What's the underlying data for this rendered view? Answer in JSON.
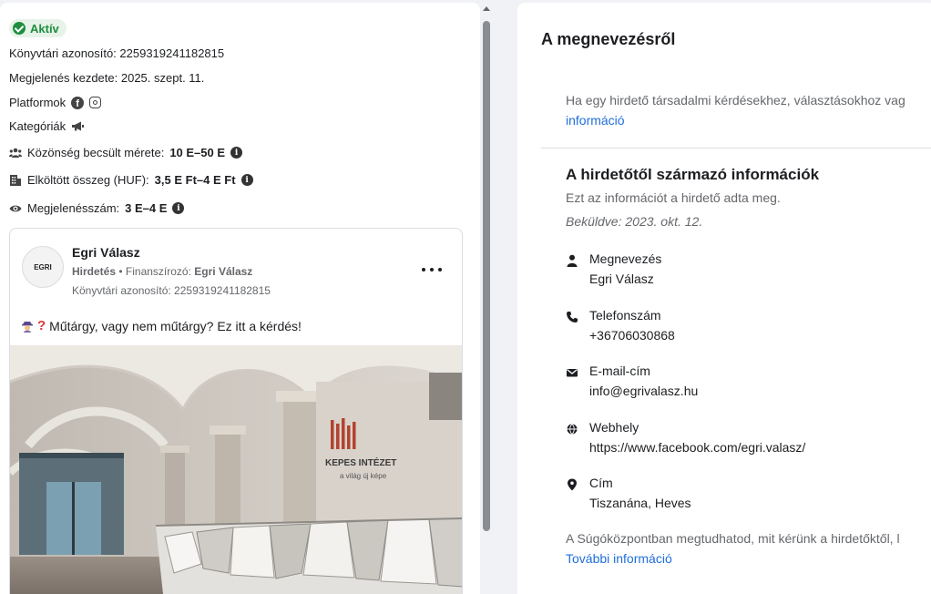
{
  "left": {
    "status": "Aktív",
    "library_id_line": "Könyvtári azonosító: 2259319241182815",
    "start_line": "Megjelenés kezdete: 2025. szept. 11.",
    "platforms_label": "Platformok",
    "categories_label": "Kategóriák",
    "audience_label": "Közönség becsült mérete:",
    "audience_value": "10 E–50 E",
    "spend_label": "Elköltött összeg (HUF):",
    "spend_value": "3,5 E Ft–4 E Ft",
    "impressions_label": "Megjelenésszám:",
    "impressions_value": "3 E–4 E"
  },
  "ad": {
    "avatar_text": "EGRI",
    "page_name": "Egri Válasz",
    "sponsored_label": "Hirdetés",
    "funded_by_label": " • Finanszírozó: ",
    "funded_by_value": "Egri Válasz",
    "library_id_line": "Könyvtári azonosító: 2259319241182815",
    "text": "Műtárgy, vagy nem műtárgy? Ez itt a kérdés!",
    "image_sign_line1": "KEPES INTÉZET",
    "image_sign_line2": "a világ új képe"
  },
  "right": {
    "title": "A megnevezésről",
    "intro": "Ha egy hirdető társadalmi kérdésekhez, választásokhoz vag",
    "intro_link": "információ",
    "section_title": "A hirdetőtől származó információk",
    "section_desc": "Ezt az információt a hirdető adta meg.",
    "submitted": "Beküldve: 2023. okt. 12.",
    "rows": [
      {
        "icon": "person-icon",
        "label": "Megnevezés",
        "value": "Egri Válasz"
      },
      {
        "icon": "phone-icon",
        "label": "Telefonszám",
        "value": "+36706030868"
      },
      {
        "icon": "mail-icon",
        "label": "E-mail-cím",
        "value": "info@egrivalasz.hu"
      },
      {
        "icon": "globe-icon",
        "label": "Webhely",
        "value": "https://www.facebook.com/egri.valasz/"
      },
      {
        "icon": "location-pin-icon",
        "label": "Cím",
        "value": "Tiszanána, Heves"
      }
    ],
    "footer": "A Súgóközpontban megtudhatod, mit kérünk a hirdetőktől, l",
    "footer_link": "További információ"
  },
  "colors": {
    "accent_green": "#1e8e3e",
    "link_blue": "#216fdb",
    "muted_text": "#65676b"
  }
}
